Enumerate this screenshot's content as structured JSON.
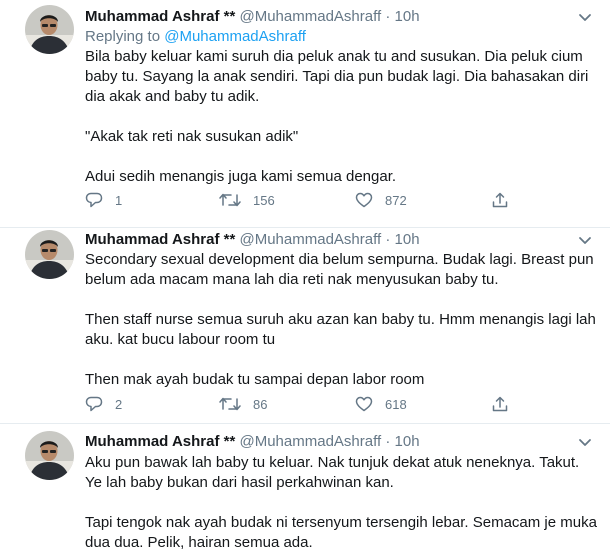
{
  "tweets": [
    {
      "name": "Muhammad Ashraf **",
      "handle": "@MuhammadAshraff",
      "separator": "·",
      "time": "10h",
      "replying_prefix": "Replying to ",
      "replying_to": "@MuhammadAshraff",
      "lines": [
        "Bila baby keluar kami suruh dia peluk anak tu and susukan. Dia peluk cium",
        "baby tu. Sayang la anak sendiri. Tapi dia pun budak lagi. Dia bahasakan diri",
        "dia akak and baby tu adik.",
        "",
        "\"Akak tak reti nak susukan adik\"",
        "",
        "Adui sedih menangis juga kami semua dengar."
      ],
      "replies": "1",
      "retweets": "156",
      "likes": "872"
    },
    {
      "name": "Muhammad Ashraf **",
      "handle": "@MuhammadAshraff",
      "separator": "·",
      "time": "10h",
      "lines": [
        "Secondary sexual development dia belum sempurna. Budak lagi. Breast pun",
        "belum ada macam mana lah dia reti nak menyusukan baby tu.",
        "",
        "Then staff nurse semua suruh aku azan kan baby tu. Hmm menangis lagi lah",
        "aku. kat bucu labour room tu",
        "",
        "Then mak ayah budak tu sampai depan labor room"
      ],
      "replies": "2",
      "retweets": "86",
      "likes": "618"
    },
    {
      "name": "Muhammad Ashraf **",
      "handle": "@MuhammadAshraff",
      "separator": "·",
      "time": "10h",
      "lines": [
        "Aku pun bawak lah baby tu keluar. Nak tunjuk dekat atuk neneknya. Takut.",
        "Ye lah baby bukan dari hasil perkahwinan kan.",
        "",
        "Tapi tengok nak ayah budak ni tersenyum tersengih lebar. Semacam je muka",
        "dua dua. Pelik, hairan semua ada."
      ]
    }
  ],
  "colors": {
    "accent": "#1da1f2",
    "secondary_text": "#657786",
    "divider": "#e6ecf0"
  },
  "icons": [
    "avatar",
    "chevron-down-icon",
    "reply-icon",
    "retweet-icon",
    "like-icon",
    "share-icon"
  ]
}
